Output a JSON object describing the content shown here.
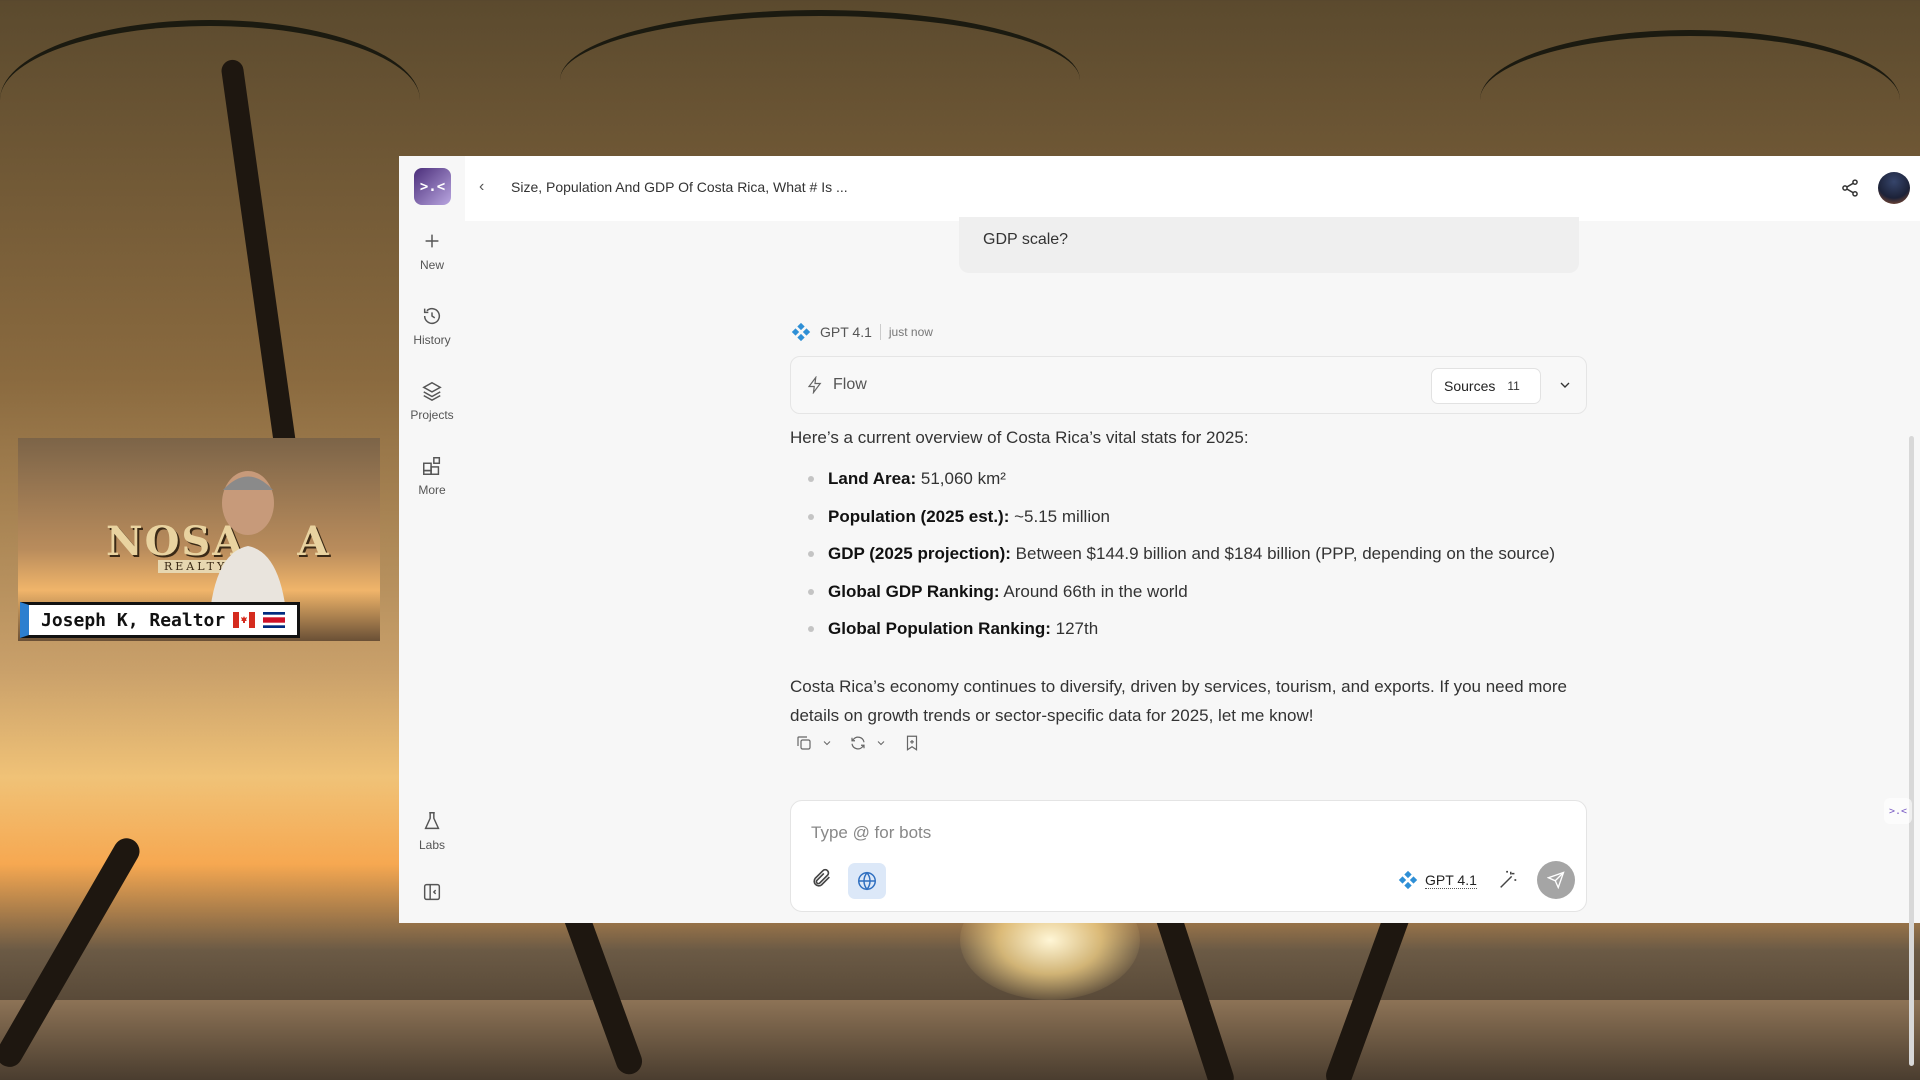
{
  "window": {
    "conversation_title": "Size, Population And GDP Of Costa Rica, What # Is ...",
    "logo_text": ">.<"
  },
  "sidebar": {
    "items": [
      {
        "label": "New",
        "icon": "plus-icon"
      },
      {
        "label": "History",
        "icon": "history-icon"
      },
      {
        "label": "Projects",
        "icon": "layers-icon"
      },
      {
        "label": "More",
        "icon": "grid-plus-icon"
      }
    ],
    "bottom": [
      {
        "label": "Labs",
        "icon": "flask-icon"
      },
      {
        "label": "",
        "icon": "sidebar-collapse-icon"
      }
    ]
  },
  "user_message": {
    "visible_text": "GDP scale?"
  },
  "bot": {
    "name": "GPT 4.1",
    "time": "just now",
    "flow_label": "Flow",
    "sources_label": "Sources",
    "sources_count": "11",
    "intro": "Here’s a current overview of Costa Rica’s vital stats for 2025:",
    "bullets": [
      {
        "label": "Land Area:",
        "value": " 51,060 km²"
      },
      {
        "label": "Population (2025 est.):",
        "value": " ~5.15 million"
      },
      {
        "label": "GDP (2025 projection):",
        "value": " Between $144.9 billion and $184 billion (PPP, depending on the source)"
      },
      {
        "label": "Global GDP Ranking:",
        "value": " Around 66th in the world"
      },
      {
        "label": "Global Population Ranking:",
        "value": " 127th"
      }
    ],
    "outro": "Costa Rica’s economy continues to diversify, driven by services, tourism, and exports. If you need more details on growth trends or sector-specific data for 2025, let me know!"
  },
  "composer": {
    "placeholder": "Type @ for bots",
    "value": "",
    "model": "GPT 4.1"
  },
  "webcam": {
    "brand_text": "NOSA",
    "brand_text_right": "A",
    "brand_sub": "REALTY G",
    "name_tag": "Joseph K, Realtor"
  },
  "colors": {
    "accent_web_button": "#dce8f8",
    "send_button": "#a5a5a5",
    "name_tag_border": "#2d7fcf",
    "bot_icon": "#2e8fd6"
  }
}
